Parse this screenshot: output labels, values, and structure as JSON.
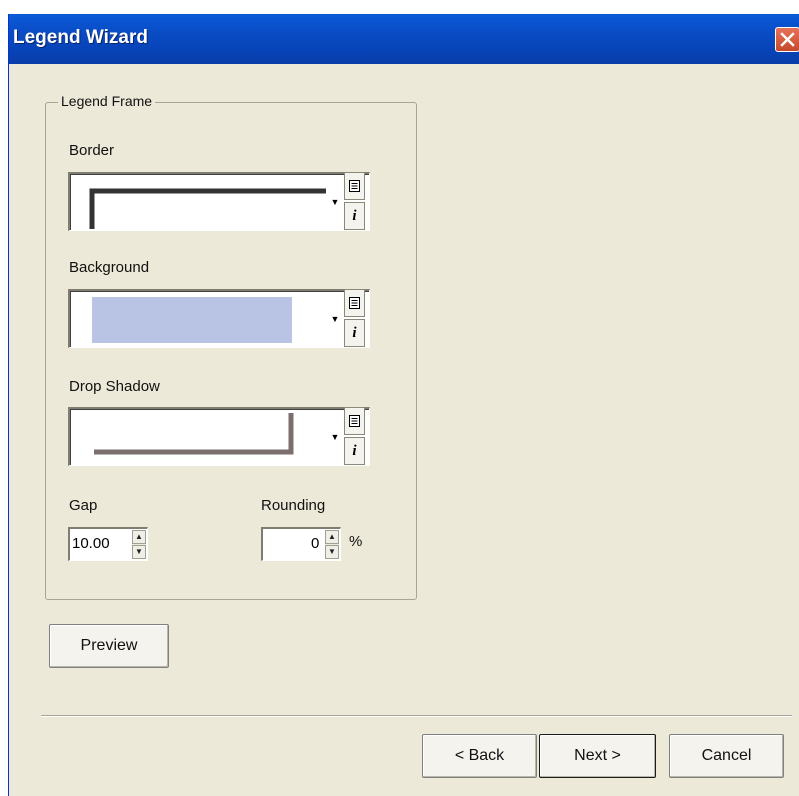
{
  "window": {
    "title": "Legend Wizard"
  },
  "group": {
    "title": "Legend Frame"
  },
  "border": {
    "label": "Border"
  },
  "background": {
    "label": "Background",
    "fill_color": "#b9c4e4"
  },
  "drop_shadow": {
    "label": "Drop Shadow"
  },
  "gap": {
    "label": "Gap",
    "value": "10.00"
  },
  "rounding": {
    "label": "Rounding",
    "value": "0",
    "unit": "%"
  },
  "buttons": {
    "preview": "Preview",
    "back": "< Back",
    "next": "Next >",
    "cancel": "Cancel"
  },
  "icons": {
    "dropdown": "triangle-down",
    "properties": "list-icon",
    "info": "info-icon",
    "close": "close-x"
  },
  "colors": {
    "titlebar": "#0a4bc4",
    "dialog_bg": "#ece9d8",
    "line_dark": "#333333",
    "shadow_line": "#7a6e6e"
  }
}
